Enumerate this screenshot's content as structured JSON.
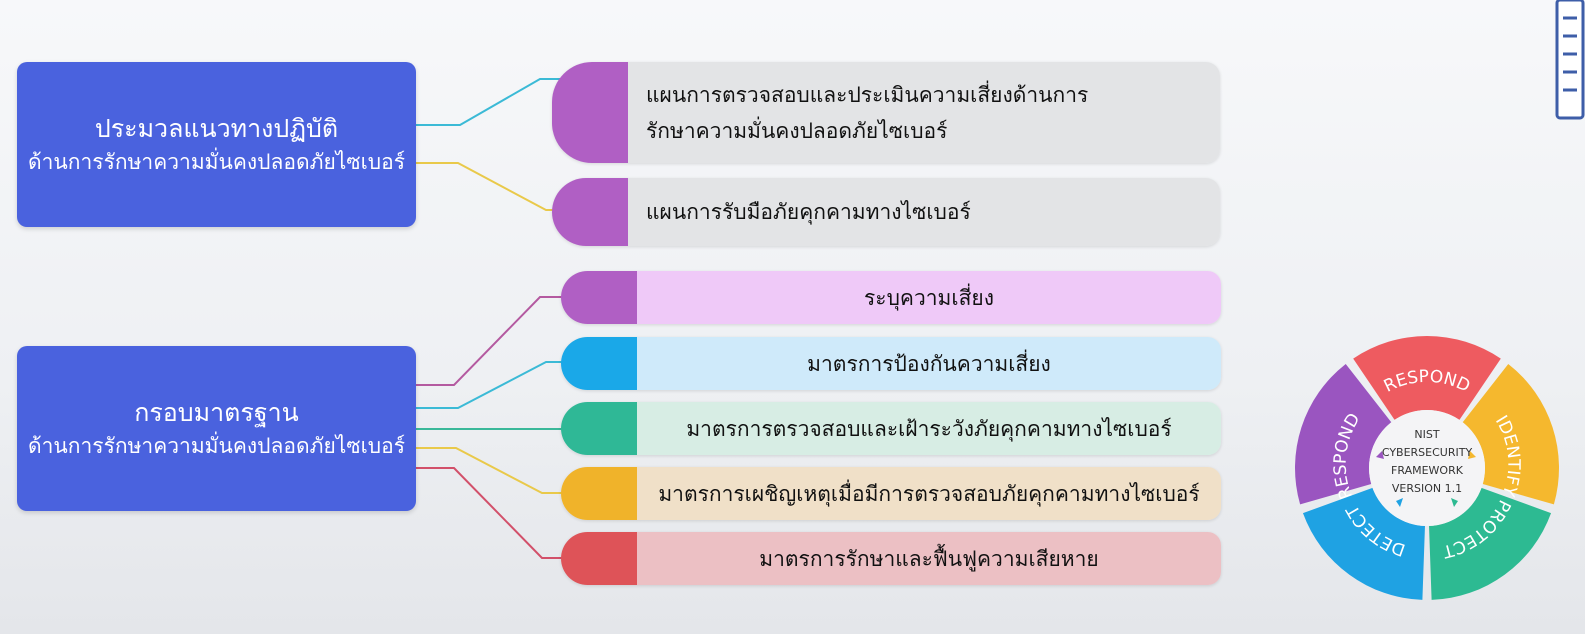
{
  "left_boxes": {
    "guidelines": {
      "line1": "ประมวลแนวทางปฏิบัติ",
      "line2": "ด้านการรักษาความมั่นคงปลอดภัยไซเบอร์"
    },
    "framework": {
      "line1": "กรอบมาตรฐาน",
      "line2": "ด้านการรักษาความมั่นคงปลอดภัยไซเบอร์"
    }
  },
  "plans": [
    {
      "line1": "แผนการตรวจสอบและประเมินความเสี่ยงด้านการ",
      "line2": "รักษาความมั่นคงปลอดภัยไซเบอร์"
    },
    {
      "line1": "แผนการรับมือภัยคุกคามทางไซเบอร์"
    }
  ],
  "measures": [
    {
      "label": "ระบุความเสี่ยง"
    },
    {
      "label": "มาตรการป้องกันความเสี่ยง"
    },
    {
      "label": "มาตรการตรวจสอบและเฝ้าระวังภัยคุกคามทางไซเบอร์"
    },
    {
      "label": "มาตรการเผชิญเหตุเมื่อมีการตรวจสอบภัยคุกคามทางไซเบอร์"
    },
    {
      "label": "มาตรการรักษาและฟื้นฟูความเสียหาย"
    }
  ],
  "colors": {
    "blue_box": "#4a62de",
    "purple": "#b05fc4",
    "cyan": "#1aa8e8",
    "teal": "#2fb896",
    "orange": "#f0b32a",
    "red": "#de5358",
    "pink_bg": "#efc9f8",
    "cyan_bg": "#cfeafa",
    "teal_bg": "#d7ede4",
    "orange_bg": "#f0e0c8",
    "red_bg": "#ecc0c4",
    "gray_bg": "#e3e4e6"
  },
  "nist_wheel": {
    "center_lines": [
      "NIST",
      "CYBERSECURITY",
      "FRAMEWORK",
      "VERSION 1.1"
    ],
    "segments": [
      {
        "label": "RESPOND",
        "color": "#ee5b60"
      },
      {
        "label": "IDENTIFY",
        "color": "#f5b82e"
      },
      {
        "label": "PROTECT",
        "color": "#2dba92"
      },
      {
        "label": "DETECT",
        "color": "#1fa2e3"
      },
      {
        "label": "RESPOND",
        "color": "#9a55c0"
      }
    ]
  }
}
